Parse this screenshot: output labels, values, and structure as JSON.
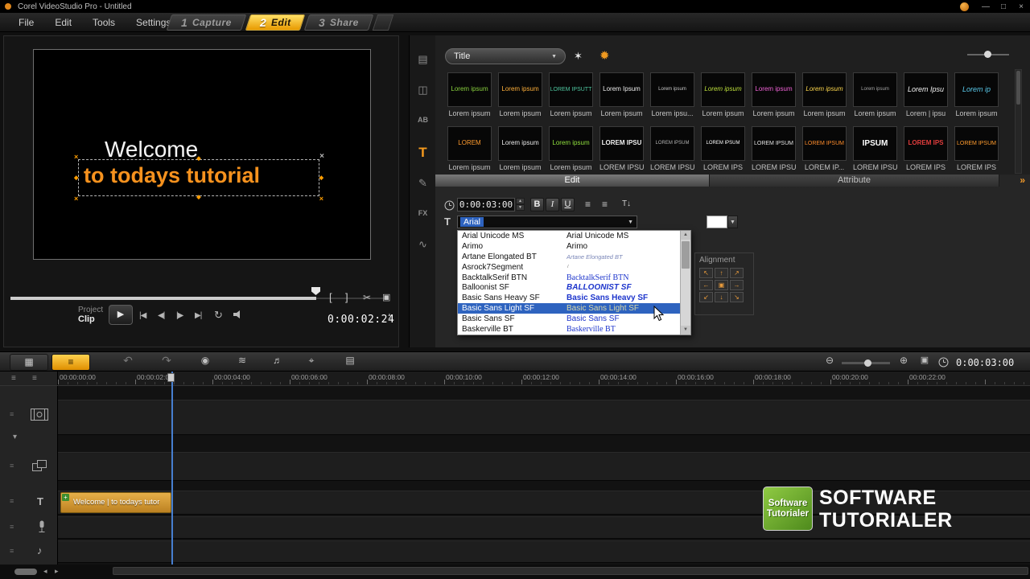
{
  "titlebar": {
    "title": "Corel VideoStudio Pro - Untitled"
  },
  "menubar": {
    "items": [
      {
        "label": "File"
      },
      {
        "label": "Edit"
      },
      {
        "label": "Tools"
      },
      {
        "label": "Settings"
      }
    ]
  },
  "steps": [
    {
      "num": "1",
      "label": "Capture",
      "active": false
    },
    {
      "num": "2",
      "label": "Edit",
      "active": true
    },
    {
      "num": "3",
      "label": "Share",
      "active": false
    }
  ],
  "preview": {
    "line1": "Welcome",
    "line2": "to todays tutorial",
    "project": "Project",
    "clip": "Clip",
    "timecode": "0:00:02:24"
  },
  "library": {
    "category_selected": "Title",
    "thumbs_row1": [
      {
        "caption": "Lorem ipsum",
        "text": "Lorem ipsum",
        "color": "#8ad23e",
        "fs": "8px"
      },
      {
        "caption": "Lorem ipsum",
        "text": "Lorem ipsum",
        "color": "#ffb03a",
        "fs": "8px"
      },
      {
        "caption": "Lorem ipsum",
        "text": "LOREM IPSUTT",
        "color": "#4fc7a0",
        "fs": "7px"
      },
      {
        "caption": "Lorem ipsum",
        "text": "Lorem Ipsum",
        "color": "#ededed",
        "fs": "8px"
      },
      {
        "caption": "Lorem ipsu...",
        "text": "Lorem ipsum",
        "color": "#c9c9c9",
        "fs": "6px"
      },
      {
        "caption": "Lorem ipsum",
        "text": "Lorem ipsum",
        "color": "#bfe23c",
        "fs": "8px",
        "fst": "italic"
      },
      {
        "caption": "Lorem ipsum",
        "text": "Lorem ipsum",
        "color": "#f263d8",
        "fs": "8px"
      },
      {
        "caption": "Lorem ipsum",
        "text": "Lorem ipsum",
        "color": "#ffd94d",
        "fs": "8px",
        "fst": "italic"
      },
      {
        "caption": "Lorem ipsum",
        "text": "Lorem ipsum",
        "color": "#a5a5a5",
        "fs": "6px"
      },
      {
        "caption": "Lorem | ipsu",
        "text": "Lorem Ipsu",
        "color": "#f2f2f2",
        "fs": "9px",
        "fst": "italic"
      },
      {
        "caption": "Lorem ipsum",
        "text": "Lorem ip",
        "color": "#59c9ea",
        "fs": "9px",
        "fst": "italic"
      }
    ],
    "thumbs_row2": [
      {
        "caption": "Lorem ipsum",
        "text": "LOREM",
        "color": "#ff9c2e",
        "fs": "8px"
      },
      {
        "caption": "Lorem ipsum",
        "text": "Lorem ipsum",
        "color": "#e9e9e9",
        "fs": "8px"
      },
      {
        "caption": "Lorem ipsum",
        "text": "Lorem ipsum",
        "color": "#90e03e",
        "fs": "8px"
      },
      {
        "caption": "LOREM IPSU",
        "text": "LOREM IPSU",
        "color": "#f2f2f2",
        "fs": "8px",
        "fw": "bold"
      },
      {
        "caption": "LOREM IPSU",
        "text": "LOREM IPSUM",
        "color": "#b3b3b3",
        "fs": "6px"
      },
      {
        "caption": "LOREM IPS",
        "text": "LOREM IPSUM",
        "color": "#ffffff",
        "fs": "6px"
      },
      {
        "caption": "LOREM IPSU",
        "text": "LOREM IPSUM",
        "color": "#e3e3e3",
        "fs": "7px"
      },
      {
        "caption": "LOREM IP...",
        "text": "LOREM IPSUM",
        "color": "#ff8d2c",
        "fs": "7px"
      },
      {
        "caption": "LOREM IPSU",
        "text": "IPSUM",
        "color": "#ffffff",
        "fs": "10px",
        "fw": "bold"
      },
      {
        "caption": "LOREM IPS",
        "text": "LOREM IPS",
        "color": "#e23d3d",
        "fs": "8px",
        "fw": "bold"
      },
      {
        "caption": "LOREM IPS",
        "text": "LOREM IPSUM",
        "color": "#ff9c2e",
        "fs": "7px"
      }
    ]
  },
  "panel_tabs": {
    "edit": "Edit",
    "attribute": "Attribute"
  },
  "edit_panel": {
    "duration": "0:00:03:00",
    "font_value": "Arial",
    "alignment_label": "Alignment",
    "alignment_grid": [
      {
        "g": "↖"
      },
      {
        "g": "↑"
      },
      {
        "g": "↗"
      },
      {
        "g": "←"
      },
      {
        "g": "▣"
      },
      {
        "g": "→"
      },
      {
        "g": "↙"
      },
      {
        "g": "↓"
      },
      {
        "g": "↘"
      }
    ],
    "font_list": [
      {
        "name": "Arial Unicode MS",
        "preview": "Arial Unicode MS",
        "row_cls": "",
        "prev_cls": ""
      },
      {
        "name": "Arimo",
        "preview": "Arimo",
        "row_cls": "",
        "prev_cls": ""
      },
      {
        "name": "Artane Elongated BT",
        "preview": "Artane Elongated BT",
        "row_cls": "",
        "prev_cls": "p-script"
      },
      {
        "name": "Asrock7Segment",
        "preview": "7",
        "row_cls": "",
        "prev_cls": "p-seg"
      },
      {
        "name": "BacktalkSerif BTN",
        "preview": "BacktalkSerif BTN",
        "row_cls": "",
        "prev_cls": "p-blue p-serif"
      },
      {
        "name": "Balloonist SF",
        "preview": "BALLOONIST SF",
        "row_cls": "",
        "prev_cls": "p-blue p-bold p-italic"
      },
      {
        "name": "Basic Sans Heavy SF",
        "preview": "Basic Sans Heavy SF",
        "row_cls": "",
        "prev_cls": "p-blue p-bold"
      },
      {
        "name": "Basic Sans Light SF",
        "preview": "Basic Sans Light SF",
        "row_cls": "selected",
        "prev_cls": "p-sel"
      },
      {
        "name": "Basic Sans SF",
        "preview": "Basic Sans SF",
        "row_cls": "",
        "prev_cls": "p-blue"
      },
      {
        "name": "Baskerville BT",
        "preview": "Baskerville BT",
        "row_cls": "",
        "prev_cls": "p-blue p-serif"
      }
    ]
  },
  "timeline": {
    "timecode": "0:00:03:00",
    "clip_label": "Welcome | to todays tutor",
    "ruler": [
      {
        "t": "00:00:00:00"
      },
      {
        "t": "00:00:02:00"
      },
      {
        "t": "00:00:04:00"
      },
      {
        "t": "00:00:06:00"
      },
      {
        "t": "00:00:08:00"
      },
      {
        "t": "00:00:10:00"
      },
      {
        "t": "00:00:12:00"
      },
      {
        "t": "00:00:14:00"
      },
      {
        "t": "00:00:16:00"
      },
      {
        "t": "00:00:18:00"
      },
      {
        "t": "00:00:20:00"
      },
      {
        "t": "00:00:22:00"
      }
    ]
  },
  "watermark": {
    "logo_line1": "Software",
    "logo_line2": "Tutorialer",
    "line1": "SOFTWARE",
    "line2": "TUTORIALER"
  },
  "icons": {
    "min": "—",
    "max": "□",
    "close": "×",
    "dropdown": "▼",
    "star_add": "✶",
    "color_wheel": "✹",
    "play": "▶",
    "home": "|◀",
    "prev_frame": "◀|",
    "next_frame": "|▶",
    "end": "▶|",
    "repeat": "↻",
    "mark_in": "[",
    "mark_out": "]",
    "split": "✂",
    "capture_frame": "▣",
    "spin_up": "▲",
    "spin_down": "▼",
    "bold": "B",
    "italic": "I",
    "underline": "U",
    "align_left": "≡",
    "align_center": "≡",
    "vertical_text": "T↓",
    "nav_media": "▤",
    "nav_transition": "◫",
    "nav_ab": "AB",
    "nav_title": "T",
    "nav_graphic": "✎",
    "nav_fx": "FX",
    "nav_path": "∿",
    "storyboard": "▦",
    "timeline_view": "≡",
    "undo": "↶",
    "redo": "↷",
    "record": "◉",
    "mixer": "≋",
    "auto_music": "♬",
    "tracking": "⌖",
    "subtitle": "▤",
    "zoom_out": "⊖",
    "zoom_in": "⊕",
    "fit": "▣",
    "chevron_expand": "»",
    "track_collapse": "▾",
    "track_menu": "≡",
    "scroll_left": "◂",
    "scroll_right": "▸",
    "clip_badge": "+",
    "music_note": "♪",
    "title_track": "T"
  }
}
